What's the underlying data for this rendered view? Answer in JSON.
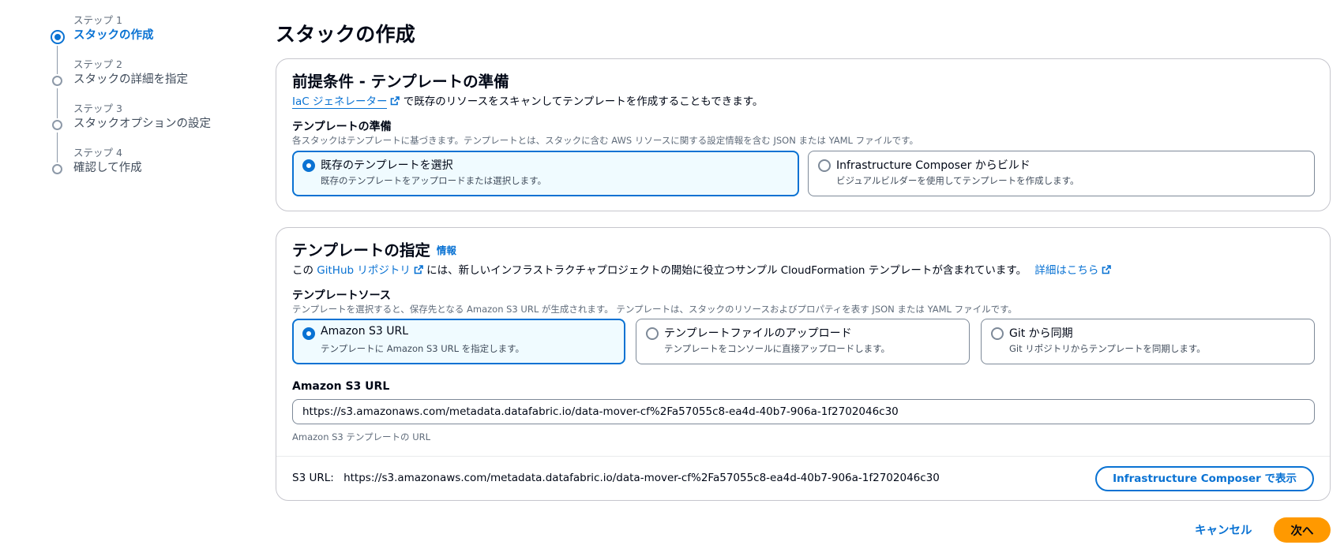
{
  "stepper": {
    "steps": [
      {
        "num": "ステップ 1",
        "name": "スタックの作成"
      },
      {
        "num": "ステップ 2",
        "name": "スタックの詳細を指定"
      },
      {
        "num": "ステップ 3",
        "name": "スタックオプションの設定"
      },
      {
        "num": "ステップ 4",
        "name": "確認して作成"
      }
    ]
  },
  "page_title": "スタックの作成",
  "prereq": {
    "heading": "前提条件 - テンプレートの準備",
    "iac_link": "IaC ジェネレーター",
    "iac_desc": "で既存のリソースをスキャンしてテンプレートを作成することもできます。",
    "label": "テンプレートの準備",
    "sub": "各スタックはテンプレートに基づきます。テンプレートとは、スタックに含む AWS リソースに関する設定情報を含む JSON または YAML ファイルです。",
    "options": [
      {
        "title": "既存のテンプレートを選択",
        "desc": "既存のテンプレートをアップロードまたは選択します。"
      },
      {
        "title": "Infrastructure Composer からビルド",
        "desc": "ビジュアルビルダーを使用してテンプレートを作成します。"
      }
    ]
  },
  "spec": {
    "heading": "テンプレートの指定",
    "info": "情報",
    "desc_prefix": "この",
    "github_link": "GitHub リポジトリ",
    "desc_middle": "には、新しいインフラストラクチャプロジェクトの開始に役立つサンプル CloudFormation テンプレートが含まれています。",
    "learn_more": "詳細はこちら",
    "source_label": "テンプレートソース",
    "source_sub": "テンプレートを選択すると、保存先となる Amazon S3 URL が生成されます。 テンプレートは、スタックのリソースおよびプロパティを表す JSON または YAML ファイルです。",
    "sources": [
      {
        "title": "Amazon S3 URL",
        "desc": "テンプレートに Amazon S3 URL を指定します。"
      },
      {
        "title": "テンプレートファイルのアップロード",
        "desc": "テンプレートをコンソールに直接アップロードします。"
      },
      {
        "title": "Git から同期",
        "desc": "Git リポジトリからテンプレートを同期します。"
      }
    ],
    "url_label": "Amazon S3 URL",
    "url_value": "https://s3.amazonaws.com/metadata.datafabric.io/data-mover-cf%2Fa57055c8-ea4d-40b7-906a-1f2702046c30",
    "url_hint": "Amazon S3 テンプレートの URL",
    "footer_label": "S3 URL:",
    "footer_url": "https://s3.amazonaws.com/metadata.datafabric.io/data-mover-cf%2Fa57055c8-ea4d-40b7-906a-1f2702046c30",
    "composer_button": "Infrastructure Composer で表示"
  },
  "actions": {
    "cancel": "キャンセル",
    "next": "次へ"
  },
  "colors": {
    "accent": "#0972d3",
    "primary_button": "#ff9900",
    "selected_tile_bg": "#f0fbff"
  }
}
